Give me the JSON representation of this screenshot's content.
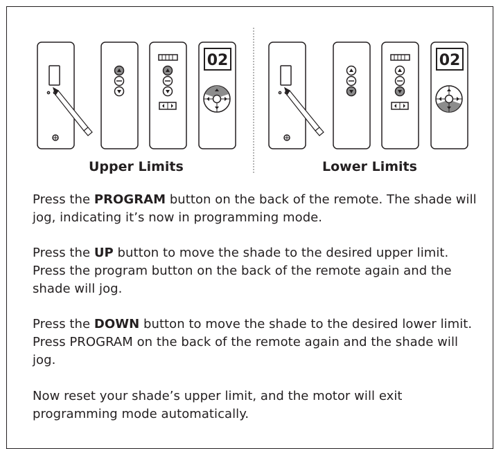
{
  "panels": {
    "left": {
      "label": "Upper Limits",
      "display_text": "02",
      "highlight": "up"
    },
    "right": {
      "label": "Lower Limits",
      "display_text": "02",
      "highlight": "down"
    }
  },
  "instructions": [
    {
      "pre": "Press the ",
      "bold": "PROGRAM",
      "post": " button on the back of the remote. The shade will jog, indicating it’s now in programming mode."
    },
    {
      "pre": "Press the ",
      "bold": "UP",
      "post": " button to move the shade to the desired upper limit. Press the program button on the back of the remote again and the shade will jog."
    },
    {
      "pre": "Press the ",
      "bold": "DOWN",
      "post": " button to move the shade to the desired lower limit. Press PROGRAM on the back of the remote again and the shade will jog."
    },
    {
      "pre": "",
      "bold": "",
      "post": "Now reset your shade’s upper limit, and the motor will exit programming mode automatically."
    }
  ],
  "colors": {
    "line": "#231f20",
    "highlight": "#8c8c8c",
    "divider": "#b5b5b5"
  }
}
